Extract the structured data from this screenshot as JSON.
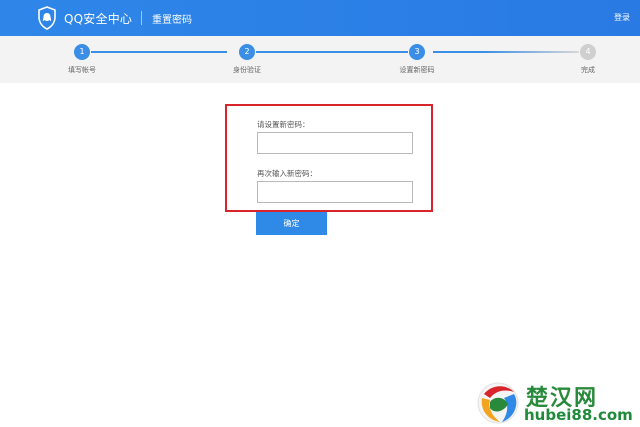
{
  "header": {
    "brand": "QQ安全中心",
    "page_name": "重置密码",
    "login": "登录",
    "icon": "qq-shield-logo"
  },
  "steps": [
    {
      "number": "1",
      "label": "填写帐号",
      "state": "done"
    },
    {
      "number": "2",
      "label": "身份验证",
      "state": "done"
    },
    {
      "number": "3",
      "label": "设置新密码",
      "state": "current"
    },
    {
      "number": "4",
      "label": "完成",
      "state": "pending"
    }
  ],
  "form": {
    "new_password_label": "请设置新密码：",
    "new_password_value": "",
    "confirm_password_label": "再次输入新密码：",
    "confirm_password_value": "",
    "submit_label": "确定"
  },
  "watermark": {
    "text_cn": "楚汉网",
    "text_en": "hubei88.com"
  },
  "colors": {
    "header": "#2b7fe6",
    "step_active": "#3a8ee6",
    "step_pending": "#cfcfcf",
    "highlight_border": "#d9242c",
    "button": "#2e8ae6"
  }
}
